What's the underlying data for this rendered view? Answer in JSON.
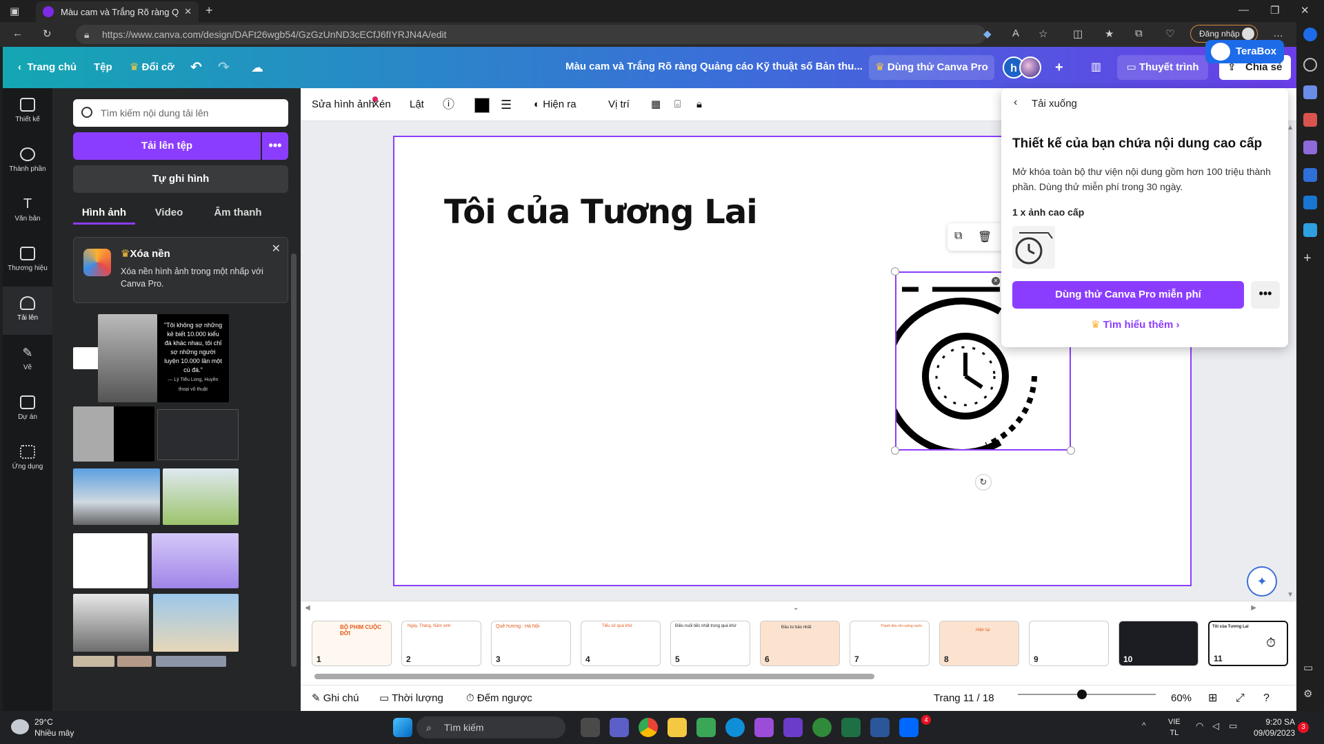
{
  "browser": {
    "tab_title": "Màu cam và Trắng Rõ ràng Quản",
    "url": "https://www.canva.com/design/DAFt26wgb54/GzGzUnND3cECfJ6fIYRJN4A/edit",
    "signin": "Đăng nhập"
  },
  "header": {
    "home": "Trang chủ",
    "file": "Tệp",
    "resize": "Đổi cỡ",
    "doc_title": "Màu cam và Trắng Rõ ràng Quảng cáo Kỹ thuật số Bản thu...",
    "try_pro": "Dùng thử Canva Pro",
    "avatar_letter": "h",
    "present": "Thuyết trình",
    "share": "Chia sẻ",
    "terabox": "TeraBox"
  },
  "rail": [
    {
      "label": "Thiết kế"
    },
    {
      "label": "Thành phần"
    },
    {
      "label": "Văn bản"
    },
    {
      "label": "Thương hiệu"
    },
    {
      "label": "Tải lên"
    },
    {
      "label": "Vẽ"
    },
    {
      "label": "Dự án"
    },
    {
      "label": "Ứng dụng"
    }
  ],
  "panel": {
    "search_placeholder": "Tìm kiếm nội dung tải lên",
    "upload_button": "Tải lên tệp",
    "more_button": "•••",
    "record_button": "Tự ghi hình",
    "tabs": [
      "Hình ảnh",
      "Video",
      "Âm thanh"
    ],
    "promo_title": "Xóa nền",
    "promo_desc": "Xóa nền hình ảnh trong một nhấp với Canva Pro.",
    "quote_text": "\"Tôi không sợ những kẻ biết 10.000 kiểu đá khác nhau, tôi chỉ sợ những người luyện 10.000 lần một cú đá.\"",
    "quote_author": "— Lý Tiểu Long, Huyền thoại võ thuật"
  },
  "toolbar": {
    "edit_image": "Sửa hình ảnh",
    "crop": "Xén",
    "flip": "Lật",
    "animate": "Hiện ra",
    "position": "Vị trí"
  },
  "canvas": {
    "heading": "Tôi của Tương Lai"
  },
  "download_popup": {
    "title": "Tải xuống",
    "heading": "Thiết kế của bạn chứa nội dung cao cấp",
    "description": "Mở khóa toàn bộ thư viện nội dung gồm hơn 100 triệu thành phần. Dùng thử miễn phí trong 30 ngày.",
    "count": "1 x ảnh cao cấp",
    "try_button": "Dùng thử Canva Pro miễn phí",
    "more": "•••",
    "learn_more": "Tìm hiểu thêm"
  },
  "filmstrip": {
    "slides": [
      {
        "num": "1",
        "title": "BỘ PHIM CUỘC ĐỜI"
      },
      {
        "num": "2",
        "title": "Ngày, Tháng, Năm sinh"
      },
      {
        "num": "3",
        "title": "Quê hương : Hà Nội"
      },
      {
        "num": "4",
        "title": "Tiểu sử quá khứ"
      },
      {
        "num": "5",
        "title": "Điều nuối tiếc nhất trong quá khứ"
      },
      {
        "num": "6",
        "title": "Đầu tư bảo nhất"
      },
      {
        "num": "7",
        "title": "Thành tiêu nổi cuống nước"
      },
      {
        "num": "8",
        "title": "Hiện tại"
      },
      {
        "num": "9",
        "title": ""
      },
      {
        "num": "10",
        "title": ""
      },
      {
        "num": "11",
        "title": "Tôi của Tương Lai"
      }
    ]
  },
  "bottombar": {
    "notes": "Ghi chú",
    "duration": "Thời lượng",
    "timer": "Đếm ngược",
    "page": "Trang 11 / 18",
    "zoom": "60%"
  },
  "taskbar": {
    "temperature": "29°C",
    "weather": "Nhiều mây",
    "search": "Tìm kiếm",
    "lang1": "VIE",
    "lang2": "TL",
    "time": "9:20 SA",
    "date": "09/09/2023",
    "notif": "3",
    "zalo_badge": "4"
  },
  "colors": {
    "purple": "#8b3dff",
    "header_start": "#14a7b3",
    "header_end": "#6a3ee8"
  }
}
